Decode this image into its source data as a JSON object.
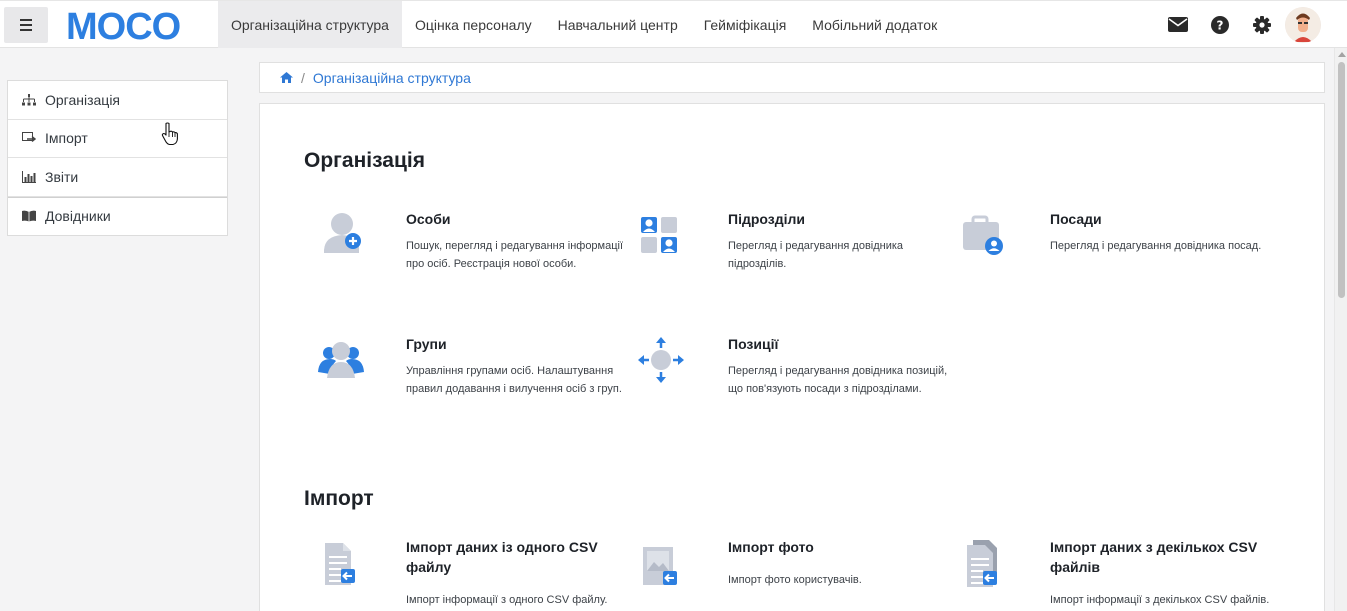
{
  "topbar": {
    "brand": "MOCO",
    "nav": [
      {
        "label": "Організаційна структура",
        "active": true
      },
      {
        "label": "Оцінка персоналу"
      },
      {
        "label": "Навчальний центр"
      },
      {
        "label": "Гейміфікація"
      },
      {
        "label": "Мобільний додаток"
      }
    ],
    "icons": [
      "envelope-icon",
      "help-icon",
      "gear-icon",
      "user-avatar"
    ]
  },
  "sidebar": {
    "items": [
      {
        "label": "Організація",
        "icon": "org-chart-icon"
      },
      {
        "label": "Імпорт",
        "icon": "import-icon"
      },
      {
        "label": "Звіти",
        "icon": "bar-chart-icon"
      },
      {
        "label": "Довідники",
        "icon": "book-icon"
      }
    ]
  },
  "breadcrumb": {
    "home_icon": "home-icon",
    "current": "Організаційна структура"
  },
  "sections": {
    "org": {
      "title": "Організація",
      "tiles": [
        {
          "title": "Особи",
          "desc1": "Пошук, перегляд і редагування інформації",
          "desc2": "про осіб. Реєстрація нової особи.",
          "icon": "person-add-icon"
        },
        {
          "title": "Підрозділи",
          "desc1": "Перегляд і редагування довідника",
          "desc2": "підрозділів.",
          "icon": "departments-icon"
        },
        {
          "title": "Посади",
          "desc1": "Перегляд і редагування довідника посад.",
          "desc2": "",
          "icon": "briefcase-user-icon"
        },
        {
          "title": "Групи",
          "desc1": "Управління групами осіб. Налаштування",
          "desc2": "правил додавання і вилучення осіб з груп.",
          "icon": "group-icon"
        },
        {
          "title": "Позиції",
          "desc1": "Перегляд і редагування довідника позицій,",
          "desc2": "що пов'язують посади з підрозділами.",
          "icon": "positions-icon"
        }
      ]
    },
    "import": {
      "title": "Імпорт",
      "tiles": [
        {
          "title": "Імпорт даних із одного CSV файлу",
          "desc1": "Імпорт інформації з одного CSV файлу.",
          "icon": "csv-import-icon"
        },
        {
          "title": "Імпорт фото",
          "desc1": "Імпорт фото користувачів.",
          "icon": "photo-import-icon"
        },
        {
          "title": "Імпорт даних з декількох CSV файлів",
          "desc1": "Імпорт інформації з декількох CSV файлів.",
          "icon": "multi-csv-import-icon"
        }
      ]
    }
  }
}
